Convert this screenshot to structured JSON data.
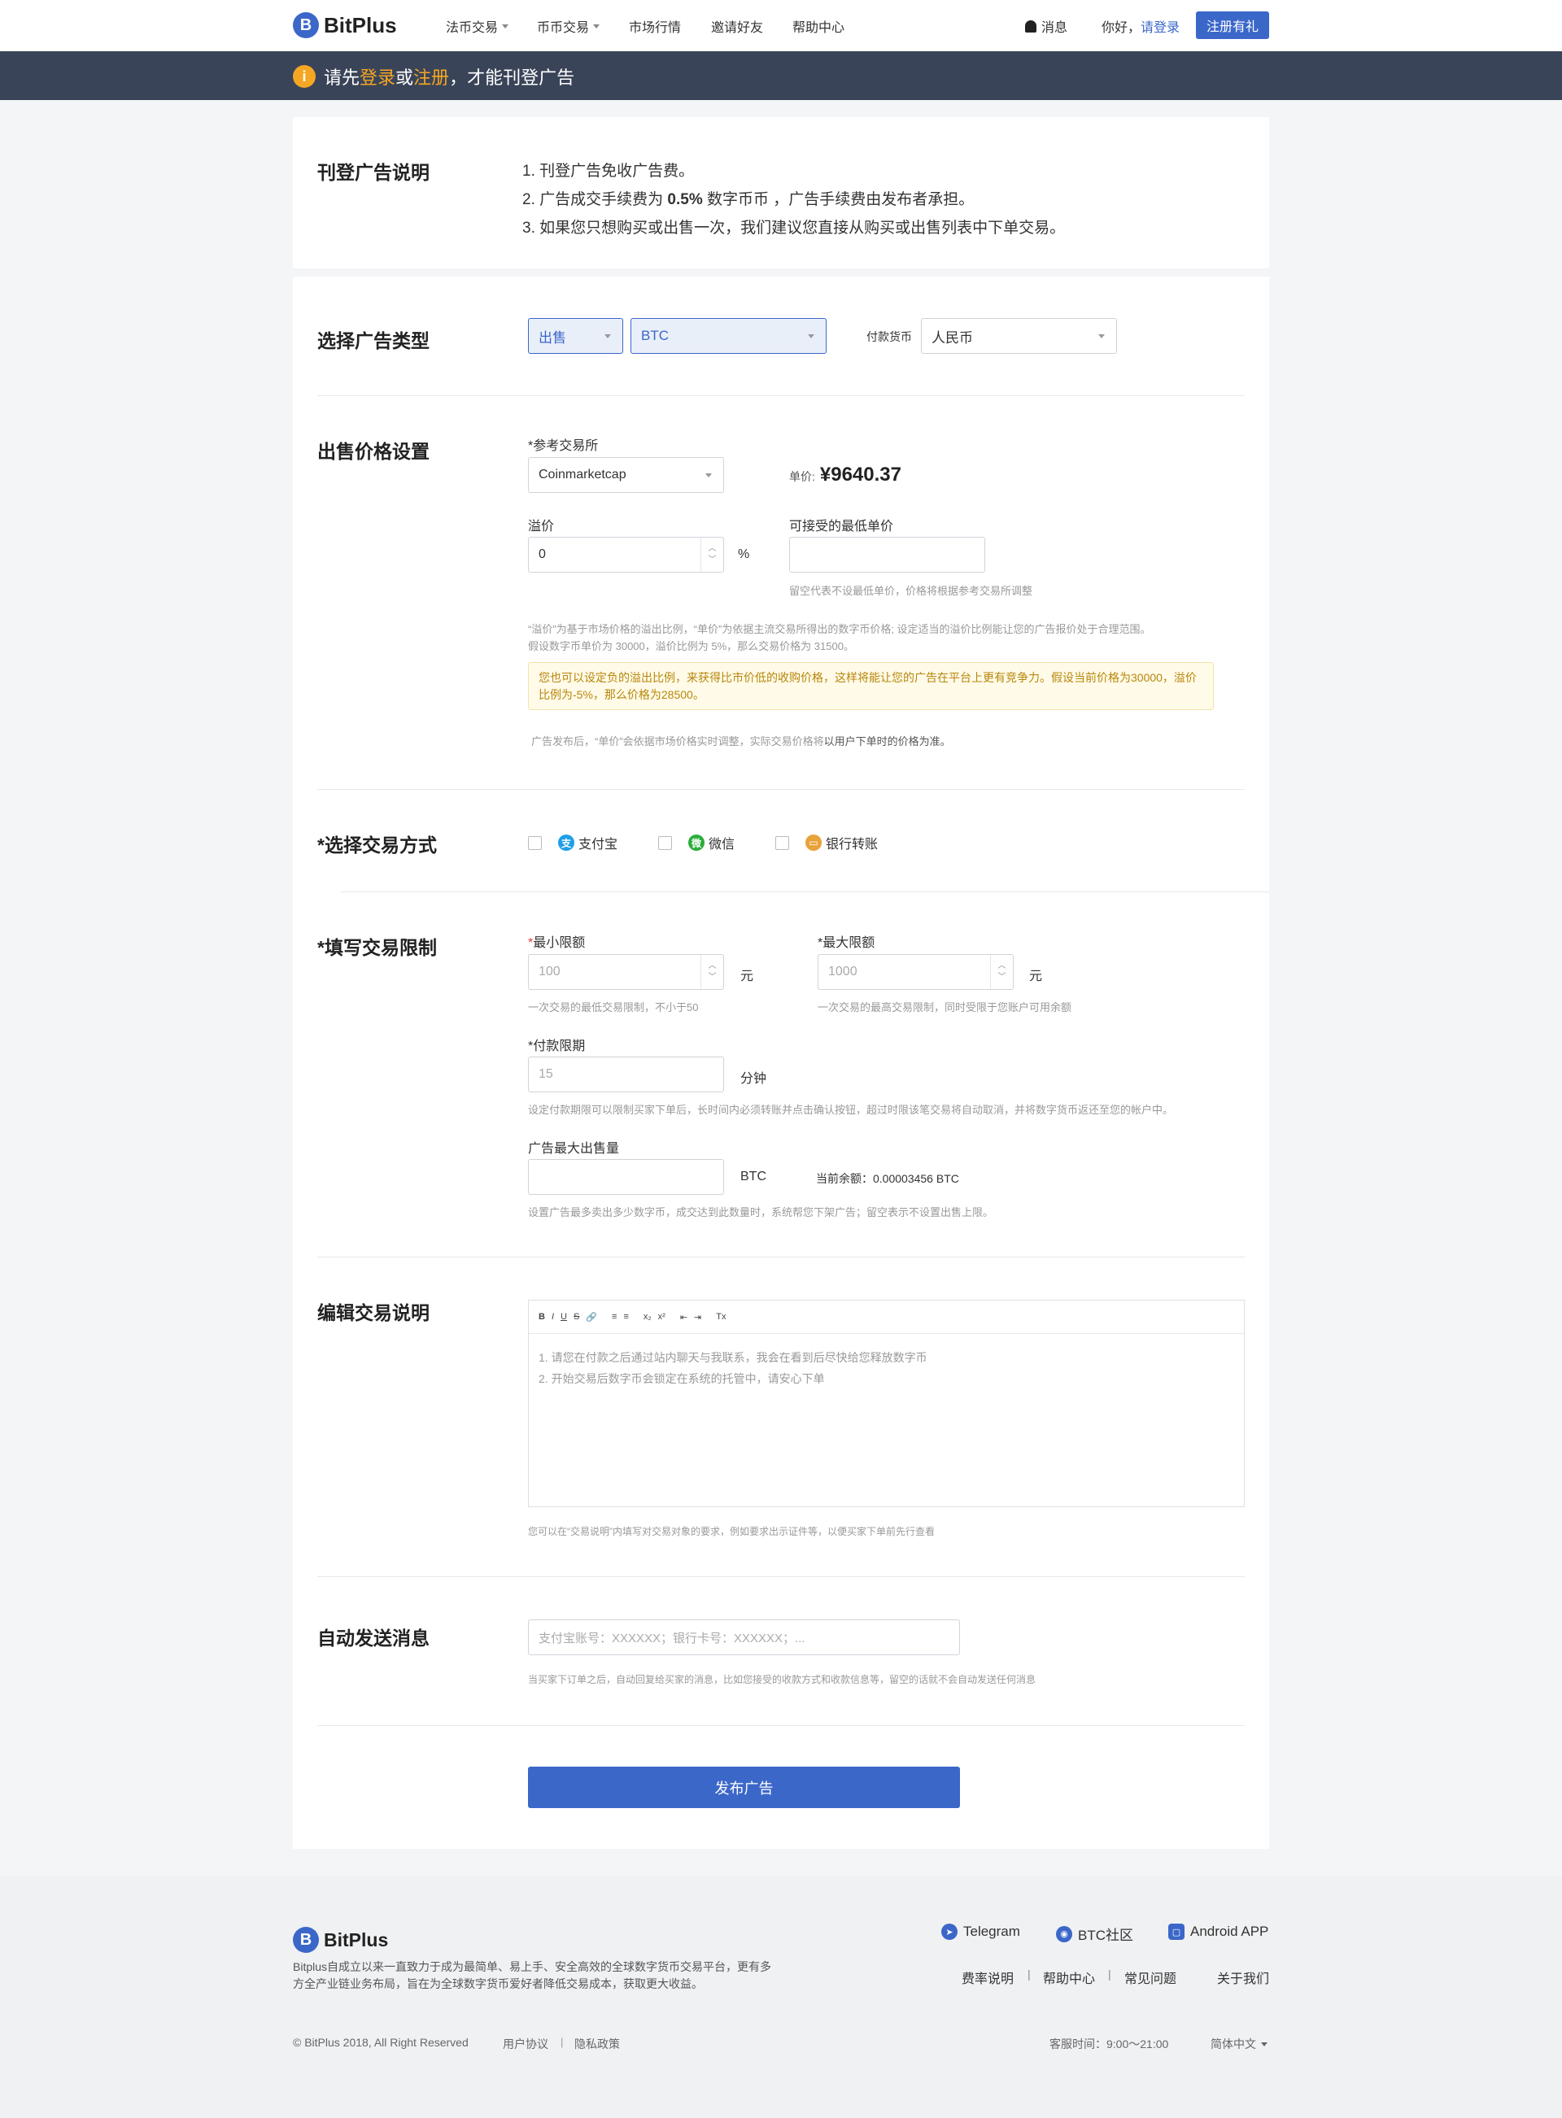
{
  "nav": {
    "brand": "BitPlus",
    "brand_mark": "B",
    "items": [
      "法币交易",
      "币币交易",
      "市场行情",
      "邀请好友",
      "帮助中心"
    ],
    "messages": "消息",
    "greeting": "你好，",
    "login": "请登录",
    "register": "注册有礼"
  },
  "banner": {
    "prefix": "请先",
    "login": "登录",
    "or": "或",
    "register": "注册",
    "suffix": "，才能刊登广告"
  },
  "notice": {
    "title": "刊登广告说明",
    "line1": "1. 刊登广告免收广告费。",
    "line2_a": "2. 广告成交手续费为 ",
    "line2_rate": "0.5%",
    "line2_b": " 数字币币 ，广告手续费由发布者承担。",
    "line3": "3. 如果您只想购买或出售一次，我们建议您直接从购买或出售列表中下单交易。"
  },
  "ad_type": {
    "title": "选择广告类型",
    "side": "出售",
    "coin": "BTC",
    "currency_label": "付款货币",
    "currency": "人民币"
  },
  "pricing": {
    "title": "出售价格设置",
    "exchange_label": "*参考交易所",
    "exchange": "Coinmarketcap",
    "unit_price_label": "单价:",
    "unit_price": "¥9640.37",
    "premium_label": "溢价",
    "premium_value": "0",
    "percent": "%",
    "min_price_label": "可接受的最低单价",
    "min_price_hint": "留空代表不设最低单价，价格将根据参考交易所调整",
    "explain_1": "“溢价”为基于市场价格的溢出比例，“单价”为依据主流交易所得出的数字币价格; 设定适当的溢价比例能让您的广告报价处于合理范围。",
    "explain_2": "假设数字币单价为 30000，溢价比例为 5%，那么交易价格为 31500。",
    "warn": "您也可以设定负的溢出比例，来获得比市价低的收购价格，这样将能让您的广告在平台上更有竞争力。假设当前价格为30000，溢价比例为-5%，那么价格为28500。",
    "after_a": "广告发布后，“单价”会依据市场价格实时调整，实际交易价格将",
    "after_b": "以用户下单时的价格为准。"
  },
  "payment": {
    "title": "*选择交易方式",
    "methods": [
      "支付宝",
      "微信",
      "银行转账"
    ],
    "colors": [
      "#1e9fe8",
      "#2aae3b",
      "#e8a23a"
    ]
  },
  "limits": {
    "title": "*填写交易限制",
    "min_label": "最小限额",
    "min_placeholder": "100",
    "min_unit": "元",
    "min_hint": "一次交易的最低交易限制，不小于50",
    "max_label": "*最大限额",
    "max_placeholder": "1000",
    "max_unit": "元",
    "max_hint": "一次交易的最高交易限制，同时受限于您账户可用余额",
    "pay_time_label": "*付款限期",
    "pay_time_placeholder": "15",
    "pay_time_unit": "分钟",
    "pay_time_hint": "设定付款期限可以限制买家下单后，长时间内必须转账并点击确认按钮，超过时限该笔交易将自动取消，并将数字货币返还至您的帐户中。",
    "max_sell_label": "广告最大出售量",
    "max_sell_unit": "BTC",
    "balance_label": "当前余额：",
    "balance": "0.00003456 BTC",
    "max_sell_hint": "设置广告最多卖出多少数字币，成交达到此数量时，系统帮您下架广告；留空表示不设置出售上限。"
  },
  "description": {
    "title": "编辑交易说明",
    "toolbar": [
      "B",
      "I",
      "U",
      "S",
      "🔗",
      "≡",
      "≡",
      "x₂",
      "x²",
      "⇤",
      "⇥",
      "Tx"
    ],
    "line1": "1. 请您在付款之后通过站内聊天与我联系，我会在看到后尽快给您释放数字币",
    "line2": "2. 开始交易后数字币会锁定在系统的托管中，请安心下单",
    "hint": "您可以在“交易说明”内填写对交易对象的要求，例如要求出示证件等，以便买家下单前先行查看"
  },
  "auto_msg": {
    "title": "自动发送消息",
    "placeholder": "支付宝账号：XXXXXX；银行卡号：XXXXXX；...",
    "hint": "当买家下订单之后，自动回复给买家的消息，比如您接受的收款方式和收款信息等，留空的话就不会自动发送任何消息"
  },
  "publish": "发布广告",
  "footer": {
    "brand": "BitPlus",
    "desc": "Bitplus自成立以来一直致力于成为最简单、易上手、安全高效的全球数字货币交易平台，更有多方全产业链业务布局，旨在为全球数字货币爱好者降低交易成本，获取更大收益。",
    "social": [
      "Telegram",
      "BTC社区",
      "Android APP"
    ],
    "links": [
      "费率说明",
      "帮助中心",
      "常见问题",
      "关于我们"
    ],
    "copyright": "© BitPlus 2018, All Right Reserved",
    "terms": "用户协议",
    "privacy": "隐私政策",
    "service_hours": "客服时间：9:00～21:00",
    "language": "简体中文"
  }
}
